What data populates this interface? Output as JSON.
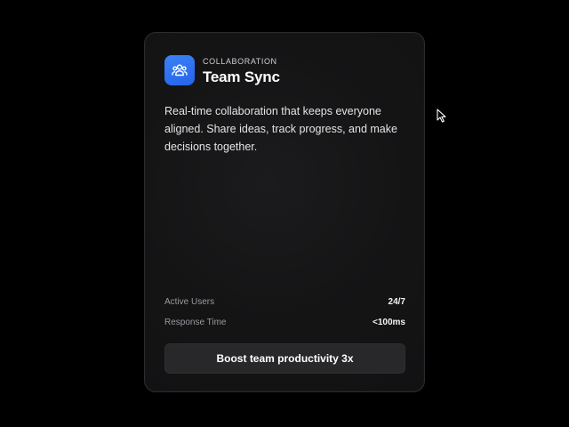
{
  "card": {
    "icon": "team-users-icon",
    "category": "COLLABORATION",
    "title": "Team Sync",
    "description": "Real-time collaboration that keeps everyone aligned. Share ideas, track progress, and make decisions together.",
    "stats": [
      {
        "label": "Active Users",
        "value": "24/7"
      },
      {
        "label": "Response Time",
        "value": "<100ms"
      }
    ],
    "cta_label": "Boost team productivity 3x"
  },
  "colors": {
    "background": "#000000",
    "card": "#141415",
    "accent": "#2563eb",
    "button": "#28282b"
  }
}
